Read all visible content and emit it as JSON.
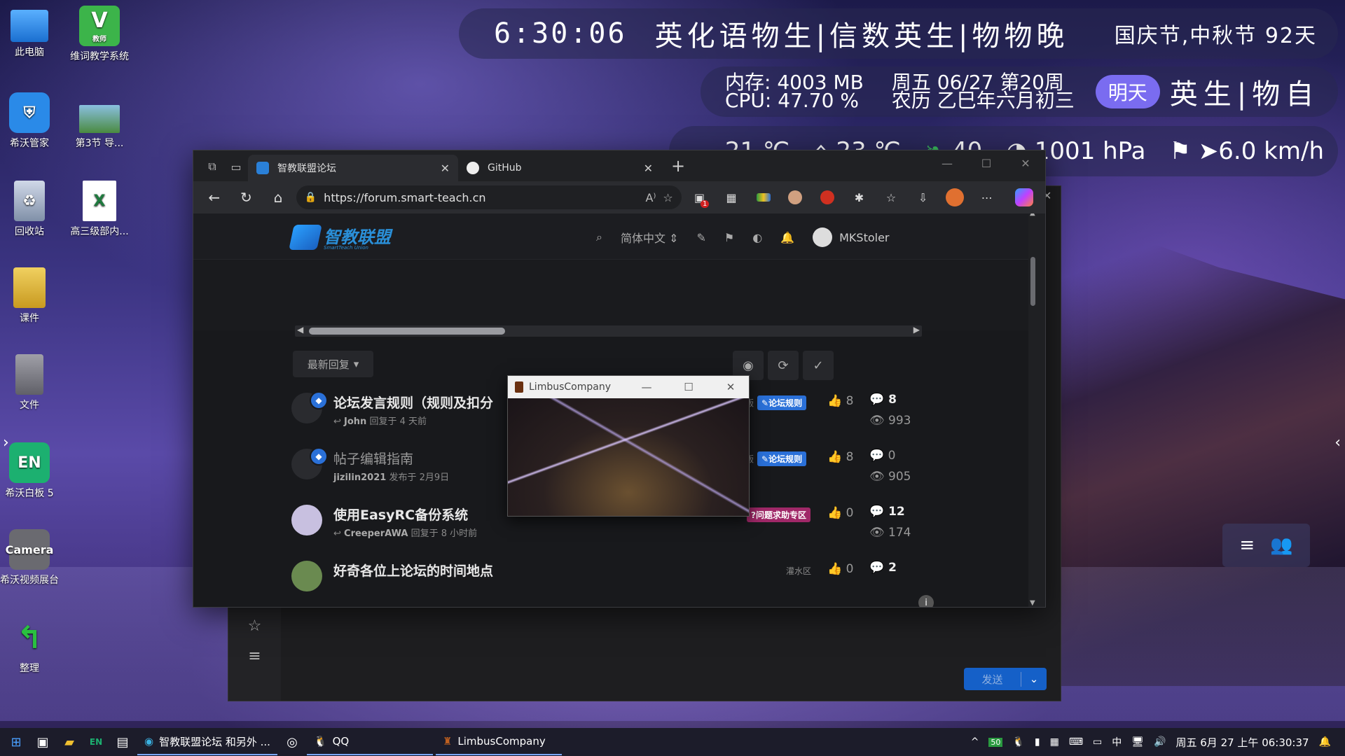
{
  "desktop": {
    "icons": [
      {
        "label": "此电脑",
        "icon": "computer-icon"
      },
      {
        "label": "维词教学系统",
        "icon": "v-app-icon",
        "badge": "教师"
      },
      {
        "label": "希沃管家",
        "icon": "shield-icon"
      },
      {
        "label": "第3节  导...",
        "icon": "ppt-icon"
      },
      {
        "label": "回收站",
        "icon": "recycle-bin-icon"
      },
      {
        "label": "高三级部内...",
        "icon": "excel-icon"
      },
      {
        "label": "课件",
        "icon": "folder-icon"
      },
      {
        "label": "文件",
        "icon": "file-icon"
      },
      {
        "label": "希沃白板 5",
        "icon": "en-icon",
        "glyph": "EN"
      },
      {
        "label": "希沃视频展台",
        "icon": "camera-icon",
        "glyph": "Camera"
      },
      {
        "label": "整理",
        "icon": "arrow-icon"
      }
    ]
  },
  "widgets": {
    "time": "6:30:06",
    "schedule_today": "英化语物生|信数英生|物物晚",
    "festival": "国庆节,中秋节 92天",
    "memory": "内存: 4003 MB",
    "cpu": "CPU: 47.70 %",
    "date_line1": "周五 06/27 第20周",
    "date_line2": "农历 乙巳年六月初三",
    "tomorrow_label": "明天",
    "schedule_tomorrow": "英生|物自",
    "weather_temp1": "21 ℃",
    "weather_temp2": "23 ℃",
    "weather_aqi": "40",
    "pressure": "1001 hPa",
    "wind": "6.0 km/h"
  },
  "browser": {
    "tabs": [
      {
        "title": "智教联盟论坛",
        "active": true
      },
      {
        "title": "GitHub",
        "active": false
      }
    ],
    "url": "https://forum.smart-teach.cn",
    "ext_badge": "1"
  },
  "forum": {
    "logo_text": "智教联盟",
    "logo_sub": "SmartTeach Union",
    "language": "简体中文",
    "username": "MKStoler",
    "sort_label": "最新回复",
    "topics": [
      {
        "title": "论坛发言规则（规则及扣分",
        "user": "John",
        "meta": "回复于 4 天前",
        "prefix": "版",
        "category": "论坛规则",
        "category_color": "#2a70d8",
        "likes": "8",
        "replies": "8",
        "views": "993",
        "bold": true
      },
      {
        "title": "帖子编辑指南",
        "user": "jizilin2021",
        "meta": "发布于 2月9日",
        "prefix": "版",
        "category": "论坛规则",
        "category_color": "#2a70d8",
        "likes": "8",
        "replies": "0",
        "views": "905",
        "bold": false
      },
      {
        "title": "使用EasyRC备份系统",
        "user": "CreeperAWA",
        "meta": "回复于 8 小时前",
        "prefix": "",
        "category": "问题求助专区",
        "category_color": "#b03070",
        "likes": "0",
        "replies": "12",
        "views": "174",
        "bold": true
      },
      {
        "title": "好奇各位上论坛的时间地点",
        "user": "",
        "meta": "",
        "prefix": "",
        "category": "灌水区",
        "category_color": "#555555",
        "likes": "0",
        "replies": "2",
        "views": "",
        "bold": true
      }
    ]
  },
  "limbus": {
    "title": "LimbusCompany"
  },
  "chat": {
    "send_label": "发送"
  },
  "taskbar": {
    "apps": [
      {
        "label": "智教联盟论坛 和另外 ...",
        "active": true
      },
      {
        "label": "QQ",
        "active": true
      },
      {
        "label": "LimbusCompany",
        "active": true
      }
    ],
    "tray_badge": "50",
    "ime": "中",
    "datetime": "周五 6月 27  上午 06:30:37"
  }
}
